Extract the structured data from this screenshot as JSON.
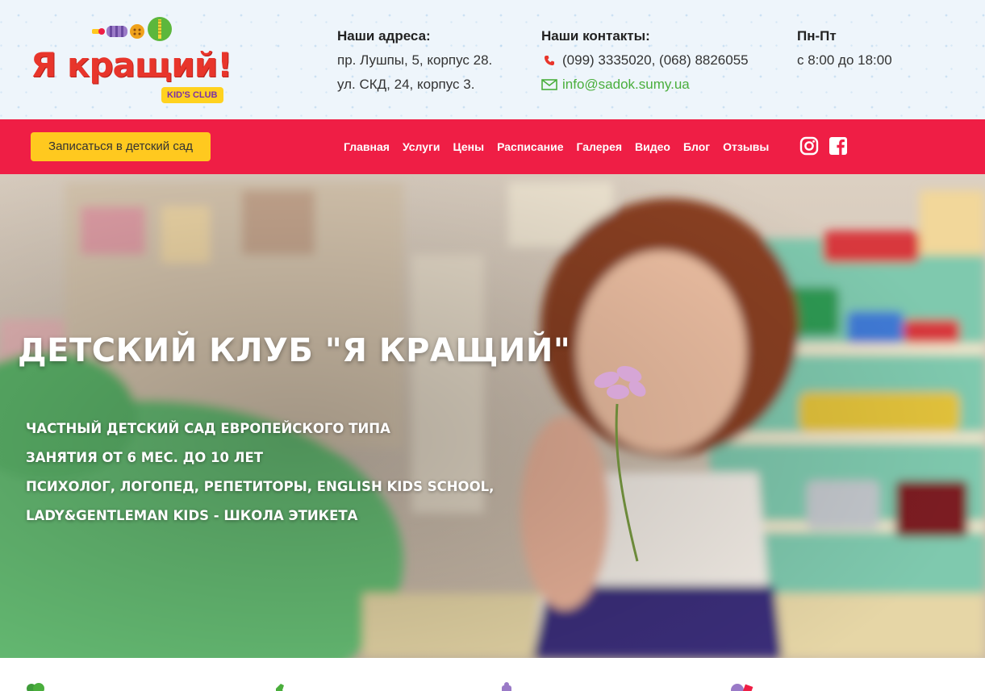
{
  "logo": {
    "text": "Я кращий!",
    "badge": "KID'S CLUB"
  },
  "address": {
    "title": "Наши адреса:",
    "lines": [
      "пр. Лушпы, 5, корпус 28.",
      "ул. СКД, 24, корпус 3."
    ]
  },
  "contacts": {
    "title": "Наши контакты:",
    "phones": "(099) 3335020, (068) 8826055",
    "email": "info@sadok.sumy.ua"
  },
  "hours": {
    "title": "Пн-Пт",
    "time": "с 8:00 до 18:00"
  },
  "nav": {
    "enroll_label": "Записаться в детский сад",
    "items": [
      "Главная",
      "Услуги",
      "Цены",
      "Расписание",
      "Галерея",
      "Видео",
      "Блог",
      "Отзывы"
    ],
    "social": [
      "instagram-icon",
      "facebook-icon"
    ]
  },
  "hero": {
    "title": "ДЕТСКИЙ КЛУБ \"Я КРАЩИЙ\"",
    "lines": [
      "ЧАСТНЫЙ ДЕТСКИЙ САД ЕВРОПЕЙСКОГО ТИПА",
      "ЗАНЯТИЯ ОТ 6 МЕС. ДО 10 ЛЕТ",
      "ПСИХОЛОГ, ЛОГОПЕД, РЕПЕТИТОРЫ, ENGLISH KIDS SCHOOL,",
      "LADY&GENTLEMAN KIDS - ШКОЛА ЭТИКЕТА"
    ]
  },
  "colors": {
    "nav_bg": "#ef1e45",
    "button_bg": "#ffc91f",
    "accent_green": "#4aae3c",
    "logo_red": "#e8352b"
  }
}
